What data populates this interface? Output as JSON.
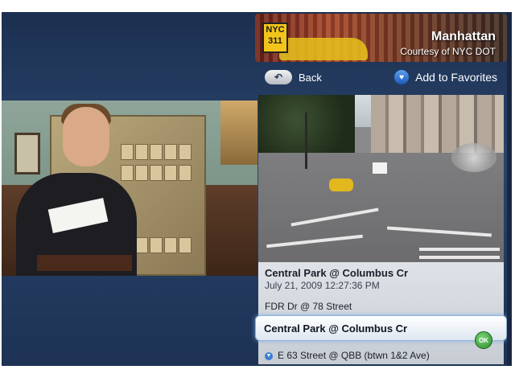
{
  "header": {
    "logo_line1": "NYC",
    "logo_line2": "311",
    "location_title": "Manhattan",
    "location_subtitle": "Courtesy of NYC DOT"
  },
  "nav": {
    "back_label": "Back",
    "back_icon": "back-arrow-icon",
    "favorites_label": "Add to Favorites",
    "favorites_icon": "heart-icon"
  },
  "camera": {
    "current_title": "Central Park @ Columbus Cr",
    "timestamp": "July 21, 2009  12:27:36 PM"
  },
  "list": {
    "items": [
      {
        "label": "FDR Dr @ 78 Street"
      },
      {
        "label": "Central Park @ Columbus Cr",
        "selected": true
      },
      {
        "label": "E 63 Street @ QBB (btwn 1&2 Ave)"
      }
    ],
    "ok_label": "OK",
    "scroll_icon": "chevron-down-icon"
  },
  "colors": {
    "background": "#1d3254",
    "selection_glow": "#8fb2d8",
    "ok_green": "#2c8a2c"
  }
}
